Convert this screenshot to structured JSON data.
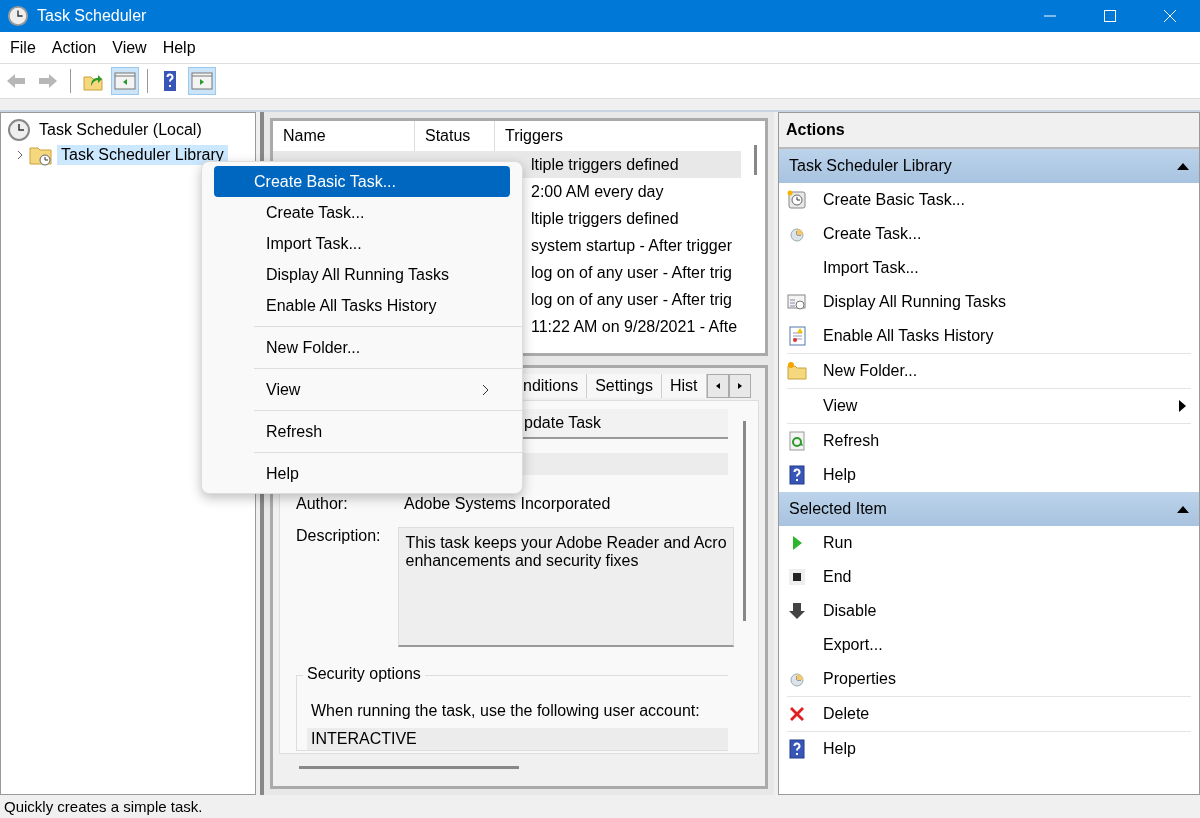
{
  "window": {
    "title": "Task Scheduler"
  },
  "menu_bar": [
    "File",
    "Action",
    "View",
    "Help"
  ],
  "toolbar": [
    {
      "pressed": false,
      "disabled": true
    },
    {
      "pressed": false,
      "disabled": true
    },
    {
      "pressed": false,
      "disabled": false
    },
    {
      "pressed": true,
      "disabled": false
    },
    {
      "pressed": false,
      "disabled": false
    },
    {
      "pressed": true,
      "disabled": false
    }
  ],
  "tree": [
    {
      "label": "Task Scheduler (Local)",
      "selected": false,
      "children": [
        {
          "label": "Task Scheduler Library",
          "selected": true,
          "expanded": false
        }
      ]
    }
  ],
  "task_list": {
    "columns": [
      "Name",
      "Status",
      "Triggers"
    ],
    "rows": [
      {
        "triggers": "ltiple triggers defined",
        "selected": true
      },
      {
        "triggers": "2:00 AM every day",
        "selected": false
      },
      {
        "triggers": "ltiple triggers defined",
        "selected": false
      },
      {
        "triggers": "system startup - After trigger",
        "selected": false
      },
      {
        "triggers": "log on of any user - After trig",
        "selected": false
      },
      {
        "triggers": "log on of any user - After trig",
        "selected": false
      },
      {
        "triggers": "11:22 AM on 9/28/2021 - Afte",
        "selected": false
      }
    ]
  },
  "details": {
    "tabs": [
      {
        "label": "nditions",
        "selected": false
      },
      {
        "label": "Settings",
        "selected": false
      },
      {
        "label": "Hist",
        "selected": false
      }
    ],
    "name_value": "pdate Task",
    "author_label": "Author:",
    "author_value": "Adobe Systems Incorporated",
    "description_label": "Description:",
    "description_lines": [
      "This task keeps your Adobe Reader and Acro",
      "enhancements and security fixes"
    ],
    "security_title": "Security options",
    "security_text": "When running the task, use the following user account:",
    "account": "INTERACTIVE"
  },
  "context_menu": {
    "groups": [
      [
        {
          "label": "Create Basic Task...",
          "selected": true,
          "submenu": false
        },
        {
          "label": "Create Task...",
          "selected": false,
          "submenu": false
        },
        {
          "label": "Import Task...",
          "selected": false,
          "submenu": false
        },
        {
          "label": "Display All Running Tasks",
          "selected": false,
          "submenu": false
        },
        {
          "label": "Enable All Tasks History",
          "selected": false,
          "submenu": false
        }
      ],
      [
        {
          "label": "New Folder...",
          "selected": false,
          "submenu": false
        }
      ],
      [
        {
          "label": "View",
          "selected": false,
          "submenu": true
        }
      ],
      [
        {
          "label": "Refresh",
          "selected": false,
          "submenu": false
        }
      ],
      [
        {
          "label": "Help",
          "selected": false,
          "submenu": false
        }
      ]
    ]
  },
  "actions": {
    "title": "Actions",
    "sections": [
      {
        "title": "Task Scheduler Library",
        "expanded": true,
        "groups": [
          [
            {
              "label": "Create Basic Task...",
              "submenu": false
            },
            {
              "label": "Create Task...",
              "submenu": false
            },
            {
              "label": "Import Task...",
              "submenu": false
            },
            {
              "label": "Display All Running Tasks",
              "submenu": false
            },
            {
              "label": "Enable All Tasks History",
              "submenu": false
            }
          ],
          [
            {
              "label": "New Folder...",
              "submenu": false
            }
          ],
          [
            {
              "label": "View",
              "submenu": true
            }
          ],
          [
            {
              "label": "Refresh",
              "submenu": false
            },
            {
              "label": "Help",
              "submenu": false
            }
          ]
        ]
      },
      {
        "title": "Selected Item",
        "expanded": true,
        "groups": [
          [
            {
              "label": "Run",
              "submenu": false
            },
            {
              "label": "End",
              "submenu": false
            },
            {
              "label": "Disable",
              "submenu": false
            },
            {
              "label": "Export...",
              "submenu": false
            },
            {
              "label": "Properties",
              "submenu": false
            }
          ],
          [
            {
              "label": "Delete",
              "submenu": false
            }
          ],
          [
            {
              "label": "Help",
              "submenu": false
            }
          ]
        ]
      }
    ]
  },
  "status_bar": "Quickly creates a simple task."
}
